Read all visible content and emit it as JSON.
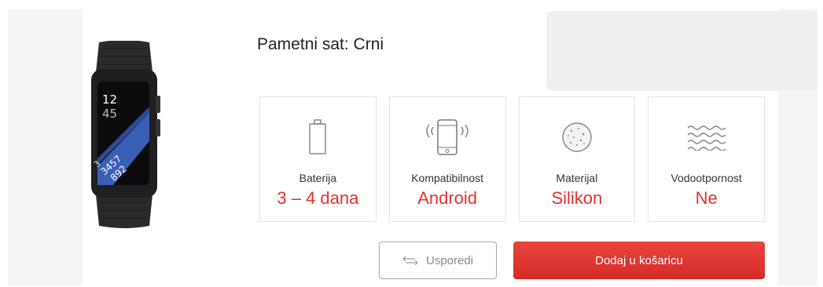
{
  "product": {
    "title": "Pametni sat: Crni",
    "watch_screen": {
      "hour": "12",
      "minute": "45",
      "stat1": "3",
      "stat2": "3457",
      "stat3": "892"
    }
  },
  "specs": [
    {
      "label": "Baterija",
      "value": "3 – 4 dana",
      "icon": "battery-icon"
    },
    {
      "label": "Kompatibilnost",
      "value": "Android",
      "icon": "phone-icon"
    },
    {
      "label": "Materijal",
      "value": "Silikon",
      "icon": "material-icon"
    },
    {
      "label": "Vodootpornost",
      "value": "Ne",
      "icon": "water-waves-icon"
    }
  ],
  "actions": {
    "compare_label": "Usporedi",
    "cart_label": "Dodaj u košaricu"
  },
  "colors": {
    "accent": "#e2322d",
    "cart_button": "#d9302c"
  }
}
